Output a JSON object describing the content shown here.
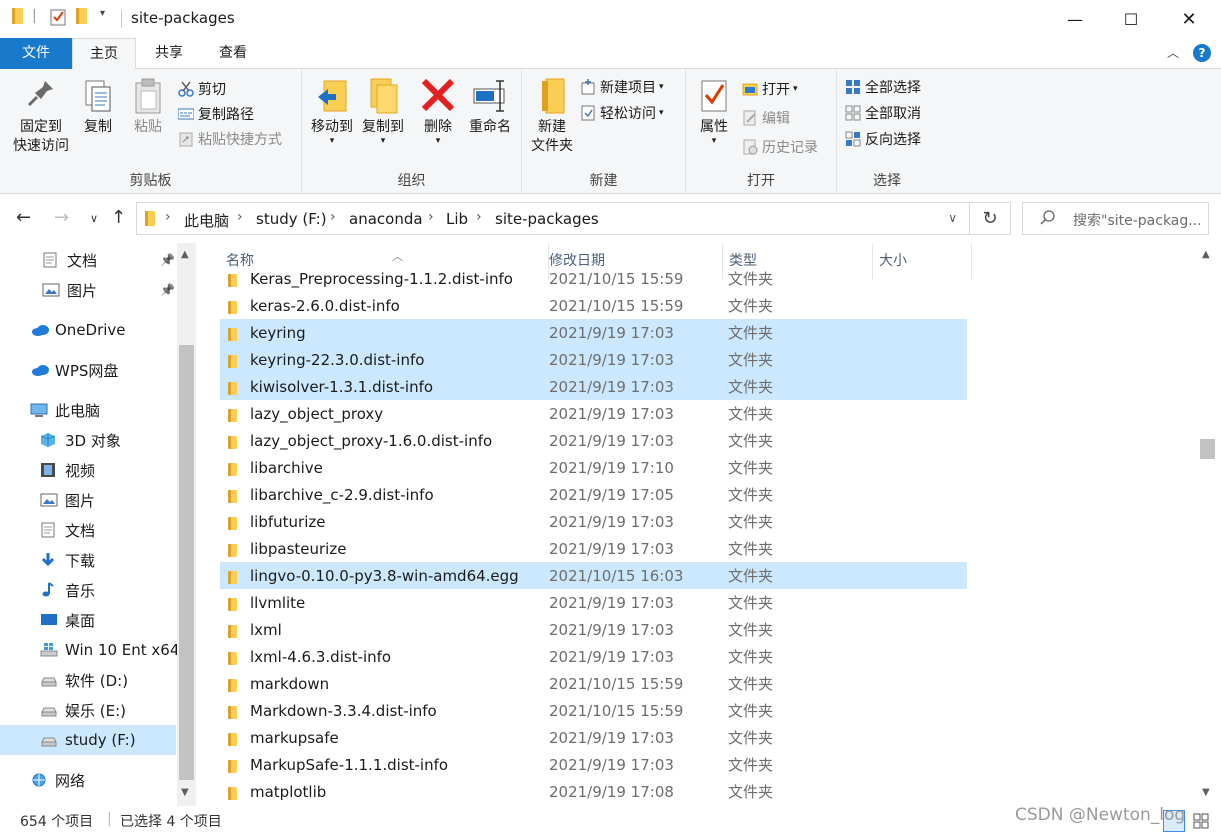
{
  "window": {
    "title": "site-packages"
  },
  "menu_tabs": {
    "file": "文件",
    "home": "主页",
    "share": "共享",
    "view": "查看"
  },
  "ribbon": {
    "clipboard": {
      "label": "剪贴板",
      "pin_label": "固定到\n快速访问",
      "copy": "复制",
      "paste": "粘贴",
      "cut": "剪切",
      "copy_path": "复制路径",
      "paste_shortcut": "粘贴快捷方式"
    },
    "organize": {
      "label": "组织",
      "move_to": "移动到",
      "copy_to": "复制到",
      "delete": "删除",
      "rename": "重命名"
    },
    "new": {
      "label": "新建",
      "new_folder": "新建\n文件夹",
      "new_item": "新建项目",
      "easy_access": "轻松访问"
    },
    "open": {
      "label": "打开",
      "properties": "属性",
      "open": "打开",
      "edit": "编辑",
      "history": "历史记录"
    },
    "select": {
      "label": "选择",
      "select_all": "全部选择",
      "select_none": "全部取消",
      "invert": "反向选择"
    }
  },
  "address": {
    "crumbs": [
      "此电脑",
      "study (F:)",
      "anaconda",
      "Lib",
      "site-packages"
    ],
    "search_placeholder": "搜索\"site-packag..."
  },
  "nav": [
    {
      "label": "文档",
      "icon": "document-icon",
      "pinned": true
    },
    {
      "label": "图片",
      "icon": "pictures-icon",
      "pinned": true
    },
    {
      "label": "OneDrive",
      "icon": "cloud-icon"
    },
    {
      "label": "WPS网盘",
      "icon": "cloud-icon"
    },
    {
      "label": "此电脑",
      "icon": "computer-icon"
    },
    {
      "label": "3D 对象",
      "icon": "cube-icon"
    },
    {
      "label": "视频",
      "icon": "video-icon"
    },
    {
      "label": "图片",
      "icon": "pictures-icon"
    },
    {
      "label": "文档",
      "icon": "document-icon"
    },
    {
      "label": "下载",
      "icon": "download-icon"
    },
    {
      "label": "音乐",
      "icon": "music-icon"
    },
    {
      "label": "桌面",
      "icon": "desktop-icon"
    },
    {
      "label": "Win 10 Ent x64",
      "icon": "windows-drive-icon"
    },
    {
      "label": "软件 (D:)",
      "icon": "drive-icon"
    },
    {
      "label": "娱乐 (E:)",
      "icon": "drive-icon"
    },
    {
      "label": "study (F:)",
      "icon": "drive-icon",
      "selected": true
    },
    {
      "label": "网络",
      "icon": "network-icon"
    }
  ],
  "columns": {
    "name": "名称",
    "date": "修改日期",
    "type": "类型",
    "size": "大小"
  },
  "files": [
    {
      "name": "Keras_Preprocessing-1.1.2.dist-info",
      "date": "2021/10/15 15:59",
      "type": "文件夹"
    },
    {
      "name": "keras-2.6.0.dist-info",
      "date": "2021/10/15 15:59",
      "type": "文件夹"
    },
    {
      "name": "keyring",
      "date": "2021/9/19 17:03",
      "type": "文件夹",
      "selected": true
    },
    {
      "name": "keyring-22.3.0.dist-info",
      "date": "2021/9/19 17:03",
      "type": "文件夹",
      "selected": true
    },
    {
      "name": "kiwisolver-1.3.1.dist-info",
      "date": "2021/9/19 17:03",
      "type": "文件夹",
      "selected": true
    },
    {
      "name": "lazy_object_proxy",
      "date": "2021/9/19 17:03",
      "type": "文件夹"
    },
    {
      "name": "lazy_object_proxy-1.6.0.dist-info",
      "date": "2021/9/19 17:03",
      "type": "文件夹"
    },
    {
      "name": "libarchive",
      "date": "2021/9/19 17:10",
      "type": "文件夹"
    },
    {
      "name": "libarchive_c-2.9.dist-info",
      "date": "2021/9/19 17:05",
      "type": "文件夹"
    },
    {
      "name": "libfuturize",
      "date": "2021/9/19 17:03",
      "type": "文件夹"
    },
    {
      "name": "libpasteurize",
      "date": "2021/9/19 17:03",
      "type": "文件夹"
    },
    {
      "name": "lingvo-0.10.0-py3.8-win-amd64.egg",
      "date": "2021/10/15 16:03",
      "type": "文件夹",
      "selected": true
    },
    {
      "name": "llvmlite",
      "date": "2021/9/19 17:03",
      "type": "文件夹"
    },
    {
      "name": "lxml",
      "date": "2021/9/19 17:03",
      "type": "文件夹"
    },
    {
      "name": "lxml-4.6.3.dist-info",
      "date": "2021/9/19 17:03",
      "type": "文件夹"
    },
    {
      "name": "markdown",
      "date": "2021/10/15 15:59",
      "type": "文件夹"
    },
    {
      "name": "Markdown-3.3.4.dist-info",
      "date": "2021/10/15 15:59",
      "type": "文件夹"
    },
    {
      "name": "markupsafe",
      "date": "2021/9/19 17:03",
      "type": "文件夹"
    },
    {
      "name": "MarkupSafe-1.1.1.dist-info",
      "date": "2021/9/19 17:03",
      "type": "文件夹"
    },
    {
      "name": "matplotlib",
      "date": "2021/9/19 17:08",
      "type": "文件夹"
    }
  ],
  "status": {
    "count": "654 个项目",
    "selected": "已选择 4 个项目"
  },
  "watermark": "CSDN @Newton_log"
}
